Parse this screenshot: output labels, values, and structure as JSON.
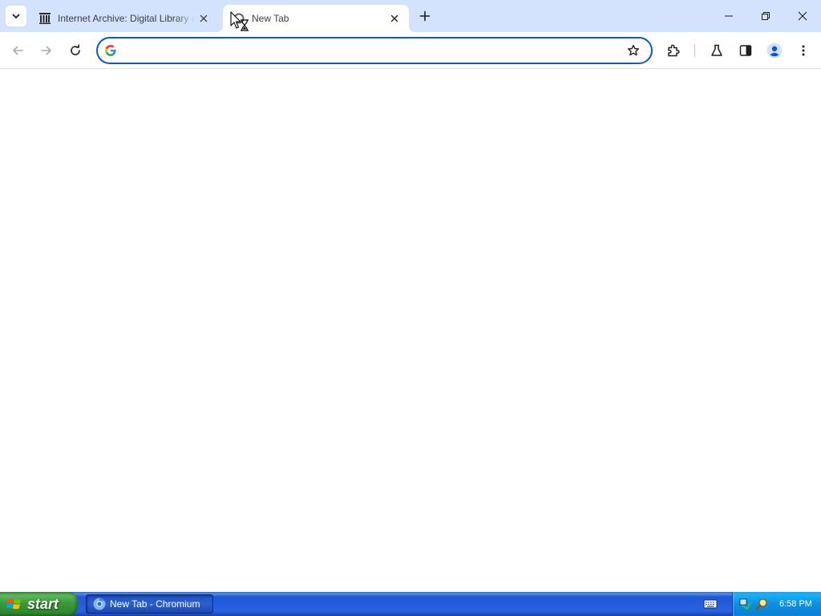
{
  "browser": {
    "tabs": [
      {
        "title": "Internet Archive: Digital Library of Free & Borrowable Books, Movies, Music & Wayback Machine",
        "favicon": "internet-archive-icon",
        "active": false
      },
      {
        "title": "New Tab",
        "favicon": "loading-spinner-icon",
        "active": true
      }
    ],
    "omnibox": {
      "value": "",
      "placeholder": ""
    },
    "window_controls": [
      "minimize",
      "restore",
      "close"
    ]
  },
  "taskbar": {
    "start_label": "start",
    "tasks": [
      {
        "label": "New Tab - Chromium",
        "icon": "chromium-icon"
      }
    ],
    "clock": "6:58 PM"
  },
  "colors": {
    "tabstrip": "#d3e3fd",
    "omnibox_focus_border": "#0b57d0",
    "taskbar_blue": "#2663e0",
    "start_green": "#3b9a3b",
    "tray_blue": "#0c8fe3"
  }
}
